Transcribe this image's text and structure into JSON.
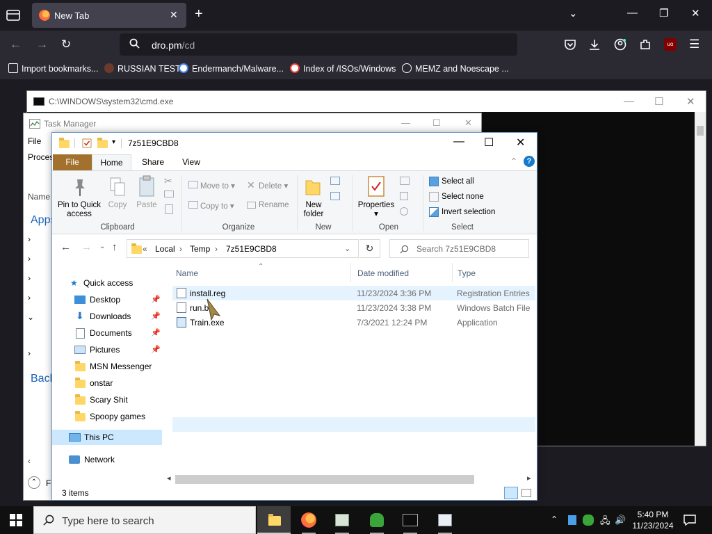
{
  "browser": {
    "tab_title": "New Tab",
    "url_domain": "dro.pm",
    "url_path": "/cd",
    "bookmarks": [
      {
        "label": "Import bookmarks..."
      },
      {
        "label": "RUSSIAN TEST"
      },
      {
        "label": "Endermanch/Malware..."
      },
      {
        "label": "Index of /ISOs/Windows"
      },
      {
        "label": "MEMZ and Noescape ..."
      }
    ],
    "ublock_badge": "uo"
  },
  "cmd": {
    "title": "C:\\WINDOWS\\system32\\cmd.exe"
  },
  "taskmgr": {
    "title": "Task Manager",
    "menu_file": "File",
    "tab_processes": "Proces",
    "col_name": "Name",
    "group_apps": "Apps",
    "group_background": "Back",
    "fewer_details": "F"
  },
  "explorer": {
    "title": "7z51E9CBD8",
    "ribbon_tabs": [
      "File",
      "Home",
      "Share",
      "View"
    ],
    "ribbon": {
      "pin": "Pin to Quick access",
      "copy": "Copy",
      "paste": "Paste",
      "move_to": "Move to",
      "copy_to": "Copy to",
      "delete": "Delete",
      "rename": "Rename",
      "new_folder": "New folder",
      "properties": "Properties",
      "select_all": "Select all",
      "select_none": "Select none",
      "invert_selection": "Invert selection",
      "groups": [
        "Clipboard",
        "Organize",
        "New",
        "Open",
        "Select"
      ]
    },
    "breadcrumb": [
      "Local",
      "Temp",
      "7z51E9CBD8"
    ],
    "search_placeholder": "Search 7z51E9CBD8",
    "nav": {
      "quick_access": "Quick access",
      "items": [
        {
          "label": "Desktop",
          "pinned": true
        },
        {
          "label": "Downloads",
          "pinned": true
        },
        {
          "label": "Documents",
          "pinned": true
        },
        {
          "label": "Pictures",
          "pinned": true
        },
        {
          "label": "MSN Messenger",
          "pinned": false
        },
        {
          "label": "onstar",
          "pinned": false
        },
        {
          "label": "Scary Shit",
          "pinned": false
        },
        {
          "label": "Spoopy games",
          "pinned": false
        }
      ],
      "this_pc": "This PC",
      "network": "Network"
    },
    "columns": [
      "Name",
      "Date modified",
      "Type"
    ],
    "files": [
      {
        "name": "install.reg",
        "date": "11/23/2024 3:36 PM",
        "type": "Registration Entries"
      },
      {
        "name": "run.b",
        "date": "11/23/2024 3:38 PM",
        "type": "Windows Batch File"
      },
      {
        "name": "Train.exe",
        "date": "7/3/2021 12:24 PM",
        "type": "Application"
      }
    ],
    "status": "3 items"
  },
  "taskbar": {
    "search_placeholder": "Type here to search",
    "time": "5:40 PM",
    "date": "11/23/2024"
  },
  "colors": {
    "firefox_bg": "#1c1b22",
    "firefox_toolbar": "#2b2a33",
    "explorer_file_tab": "#a1712d",
    "selection": "#cce8ff"
  }
}
